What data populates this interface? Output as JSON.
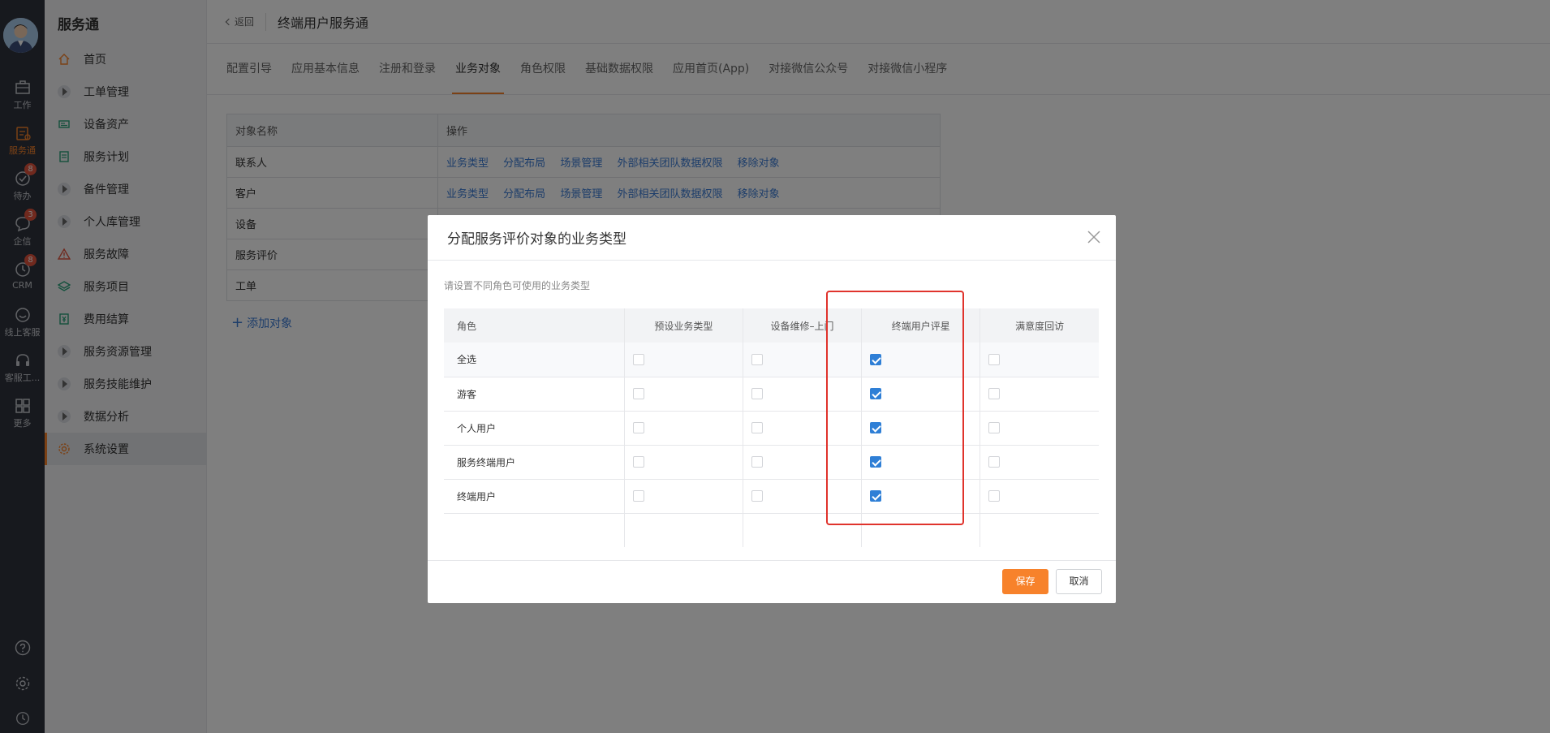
{
  "rail": {
    "items": [
      {
        "label": "工作",
        "icon": "briefcase-icon"
      },
      {
        "label": "服务通",
        "icon": "service-icon",
        "active": true
      },
      {
        "label": "待办",
        "icon": "check-circle-icon",
        "badge": "8"
      },
      {
        "label": "企信",
        "icon": "chat-icon",
        "badge": "3"
      },
      {
        "label": "CRM",
        "icon": "clock-icon",
        "badge": "8"
      },
      {
        "label": "线上客服",
        "icon": "smile-icon"
      },
      {
        "label": "客服工...",
        "icon": "headset-icon"
      },
      {
        "label": "更多",
        "icon": "grid-icon"
      }
    ]
  },
  "sidebar": {
    "title": "服务通",
    "items": [
      {
        "label": "首页"
      },
      {
        "label": "工单管理"
      },
      {
        "label": "设备资产"
      },
      {
        "label": "服务计划"
      },
      {
        "label": "备件管理"
      },
      {
        "label": "个人库管理"
      },
      {
        "label": "服务故障"
      },
      {
        "label": "服务项目"
      },
      {
        "label": "费用结算"
      },
      {
        "label": "服务资源管理"
      },
      {
        "label": "服务技能维护"
      },
      {
        "label": "数据分析"
      },
      {
        "label": "系统设置"
      }
    ]
  },
  "header": {
    "back_label": "返回",
    "title": "终端用户服务通"
  },
  "tabs": [
    "配置引导",
    "应用基本信息",
    "注册和登录",
    "业务对象",
    "角色权限",
    "基础数据权限",
    "应用首页(App)",
    "对接微信公众号",
    "对接微信小程序"
  ],
  "object_table": {
    "headers": [
      "对象名称",
      "操作"
    ],
    "rows": [
      "联系人",
      "客户",
      "设备",
      "服务评价",
      "工单"
    ],
    "ops": [
      "业务类型",
      "分配布局",
      "场景管理",
      "外部相关团队数据权限",
      "移除对象"
    ]
  },
  "add_object_label": "添加对象",
  "dialog": {
    "title": "分配服务评价对象的业务类型",
    "hint": "请设置不同角色可使用的业务类型",
    "columns": [
      "角色",
      "预设业务类型",
      "设备维修–上门",
      "终端用户评星",
      "满意度回访"
    ],
    "rows": [
      {
        "role": "全选",
        "checks": [
          false,
          false,
          true,
          false
        ]
      },
      {
        "role": "游客",
        "checks": [
          false,
          false,
          true,
          false
        ]
      },
      {
        "role": "个人用户",
        "checks": [
          false,
          false,
          true,
          false
        ]
      },
      {
        "role": "服务终端用户",
        "checks": [
          false,
          false,
          true,
          false
        ]
      },
      {
        "role": "终端用户",
        "checks": [
          false,
          false,
          true,
          false
        ]
      }
    ],
    "save_label": "保存",
    "cancel_label": "取消"
  },
  "colors": {
    "accent": "#f7822b",
    "link": "#3a7bd5",
    "checkbox": "#2f7fd6",
    "highlight": "#e0332c",
    "rail_bg": "#2f333d"
  }
}
